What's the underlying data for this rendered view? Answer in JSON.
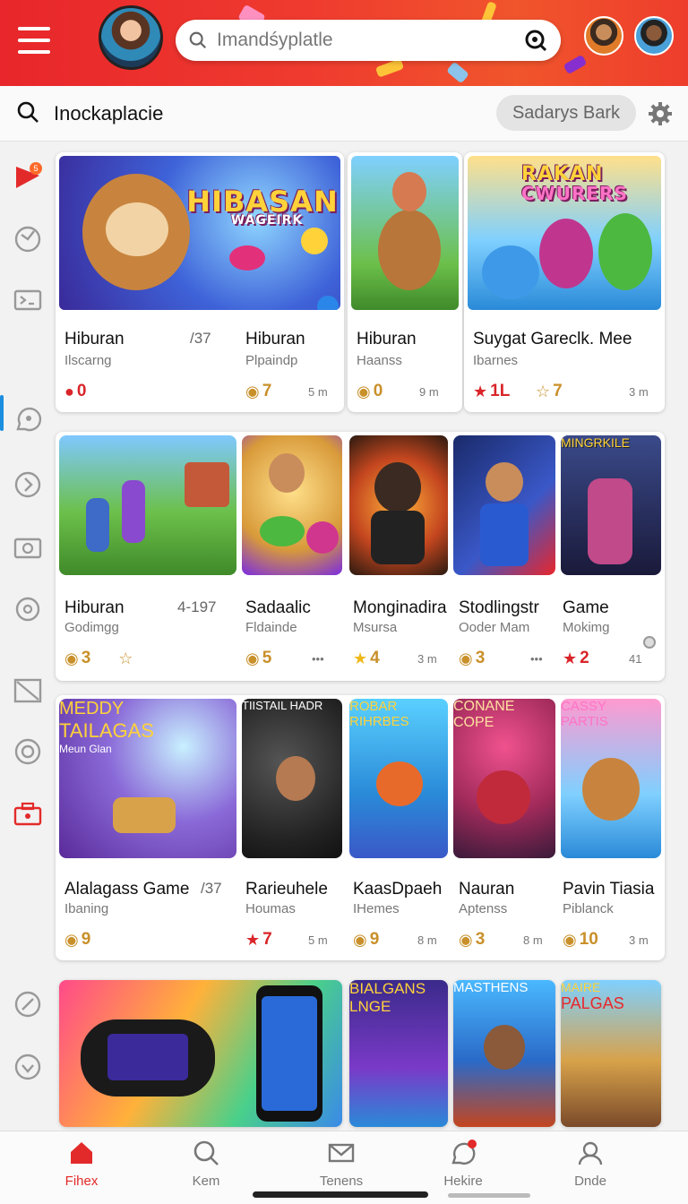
{
  "header": {
    "search_placeholder": "Imandśyplatle",
    "menu_icon": "hamburger-icon",
    "search_icon": "search-icon",
    "lens_icon": "lens-icon"
  },
  "subbar": {
    "title": "Inockaplacie",
    "pill": "Sadarys Bark"
  },
  "rows": [
    [
      {
        "name": "Hiburan",
        "sub": "Ilscarng",
        "num": "/37",
        "stat": "0",
        "stat_icon": "red-ball-icon"
      },
      {
        "name": "Hiburan",
        "sub": "Plpaindp",
        "num": "",
        "stat": "7",
        "stat_icon": "coin-icon",
        "meta": "5 m"
      },
      {
        "name": "Hiburan",
        "sub": "Haanss",
        "num": "",
        "stat": "0",
        "stat_icon": "coin-icon",
        "meta": "9 m"
      },
      {
        "name": "Suygat Gareclk.  Mee",
        "sub": "Ibarnes",
        "num": "",
        "stat": "1L",
        "stat_icon": "red-star-icon",
        "stat2": "7",
        "meta": "3 m"
      }
    ],
    [
      {
        "name": "Hiburan",
        "sub": "Godimgg",
        "num": "4-197",
        "stat": "3",
        "stat_icon": "coin-icon"
      },
      {
        "name": "Sadaalic",
        "sub": "Fldainde",
        "num": "",
        "stat": "5",
        "stat_icon": "coin-icon",
        "meta": "•••"
      },
      {
        "name": "Monginadira",
        "sub": "Msursa",
        "num": "",
        "stat": "4",
        "stat_icon": "gold-star-icon",
        "meta": "3 m"
      },
      {
        "name": "Stodlingstr",
        "sub": "Ooder Mam",
        "num": "",
        "stat": "3",
        "stat_icon": "coin-icon",
        "meta": "•••"
      },
      {
        "name": "Game",
        "sub": "Mokimg",
        "num": "",
        "stat": "2",
        "stat_icon": "red-star-icon",
        "meta": "41"
      }
    ],
    [
      {
        "name": "Alalagass Game",
        "sub": "Ibaning",
        "num": "/37",
        "stat": "9",
        "stat_icon": "coin-icon"
      },
      {
        "name": "Rarieuhele",
        "sub": "Houmas",
        "num": "",
        "stat": "7",
        "stat_icon": "red-star-icon",
        "meta": "5 m"
      },
      {
        "name": "KaasDpaeh",
        "sub": "IHemes",
        "num": "",
        "stat": "9",
        "stat_icon": "coin-icon",
        "meta": "8 m"
      },
      {
        "name": "Nauran",
        "sub": "Aptenss",
        "num": "",
        "stat": "3",
        "stat_icon": "coin-icon",
        "meta": "8 m"
      },
      {
        "name": "Pavin Tiasia",
        "sub": "Piblanck",
        "num": "",
        "stat": "10",
        "stat_icon": "coin-icon",
        "meta": "3 m"
      }
    ]
  ],
  "art_titles": {
    "r1c1": "HIBASAN",
    "r1c1b": "WAGEIRK",
    "r1c4": "RAKAN",
    "r1c4b": "CWURERS",
    "r2c5": "MINGRKILE",
    "r3c1": "MEDDY",
    "r3c1b": "TAILAGAS",
    "r3c1c": "Meun Glan",
    "r3c2": "TIISTAIL HADR",
    "r3c3": "ROBAR",
    "r3c3b": "RIHRBES",
    "r3c4": "CONANE",
    "r3c4b": "COPE",
    "r3c5": "CASSY",
    "r3c5b": "PARTIS",
    "r4c2": "BIALGANS",
    "r4c2b": "LNGE",
    "r4c3": "MASTHENS",
    "r4c4": "MAIRE",
    "r4c4b": "PALGAS"
  },
  "bottom_nav": [
    {
      "label": "Fihex",
      "icon": "home-icon"
    },
    {
      "label": "Kem",
      "icon": "search-icon"
    },
    {
      "label": "Tenens",
      "icon": "mail-icon"
    },
    {
      "label": "Hekire",
      "icon": "chat-icon"
    },
    {
      "label": "Dnde",
      "icon": "profile-icon"
    }
  ],
  "colors": {
    "brand": "#e8262b",
    "accent": "#1b8ee0",
    "coin": "#c9902a"
  }
}
